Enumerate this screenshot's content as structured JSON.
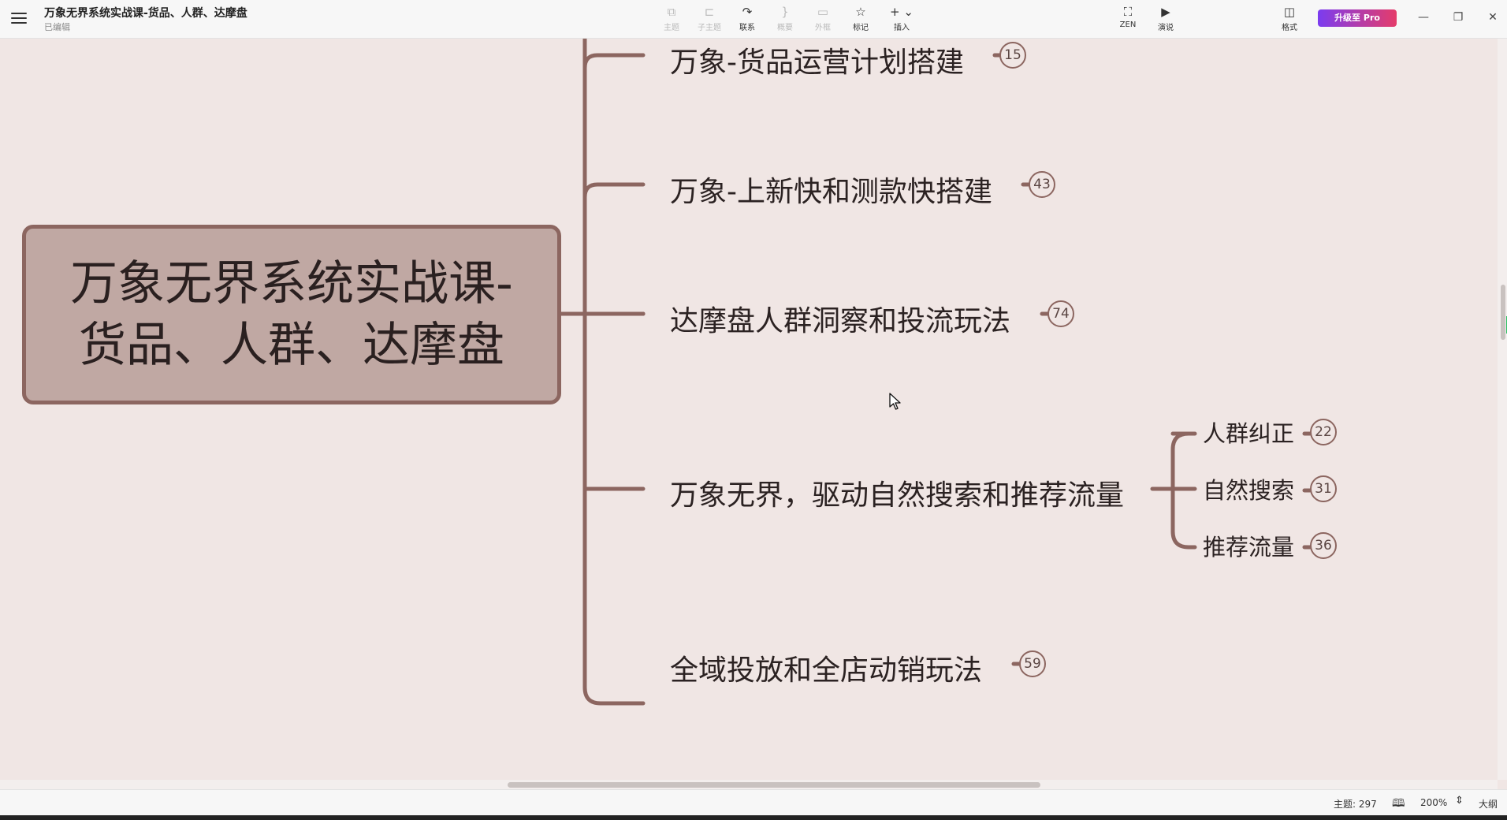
{
  "window": {
    "title": "万象无界系统实战课-货品、人群、达摩盘",
    "status": "已编辑"
  },
  "toolbar": {
    "tools": [
      {
        "label": "主题",
        "icon": "topic-icon",
        "enabled": false
      },
      {
        "label": "子主题",
        "icon": "subtopic-icon",
        "enabled": false
      },
      {
        "label": "联系",
        "icon": "relationship-icon",
        "enabled": true
      },
      {
        "label": "概要",
        "icon": "summary-icon",
        "enabled": false
      },
      {
        "label": "外框",
        "icon": "boundary-icon",
        "enabled": false
      },
      {
        "label": "标记",
        "icon": "star-icon",
        "enabled": true
      },
      {
        "label": "插入",
        "icon": "plus-icon",
        "enabled": true
      }
    ],
    "zen_label": "ZEN",
    "present_label": "演说",
    "format_label": "格式",
    "upgrade_label": "升级至 Pro"
  },
  "mindmap": {
    "root": "万象无界系统实战课-货品、人群、达摩盘",
    "root_lines": [
      "万象无界系统实战课-",
      "货品、人群、达摩盘"
    ],
    "branches": [
      {
        "label": "万象-货品运营计划搭建",
        "count": "15"
      },
      {
        "label": "万象-上新快和测款快搭建",
        "count": "43"
      },
      {
        "label": "达摩盘人群洞察和投流玩法",
        "count": "74"
      },
      {
        "label": "万象无界，驱动自然搜索和推荐流量",
        "count": null,
        "children": [
          {
            "label": "人群纠正",
            "count": "22"
          },
          {
            "label": "自然搜索",
            "count": "31"
          },
          {
            "label": "推荐流量",
            "count": "36"
          }
        ]
      },
      {
        "label": "全域投放和全店动销玩法",
        "count": "59"
      }
    ],
    "branch_color": "#8c6660"
  },
  "statusbar": {
    "topic_count": "主题: 297",
    "zoom": "200%",
    "outline_label": "大纲"
  }
}
